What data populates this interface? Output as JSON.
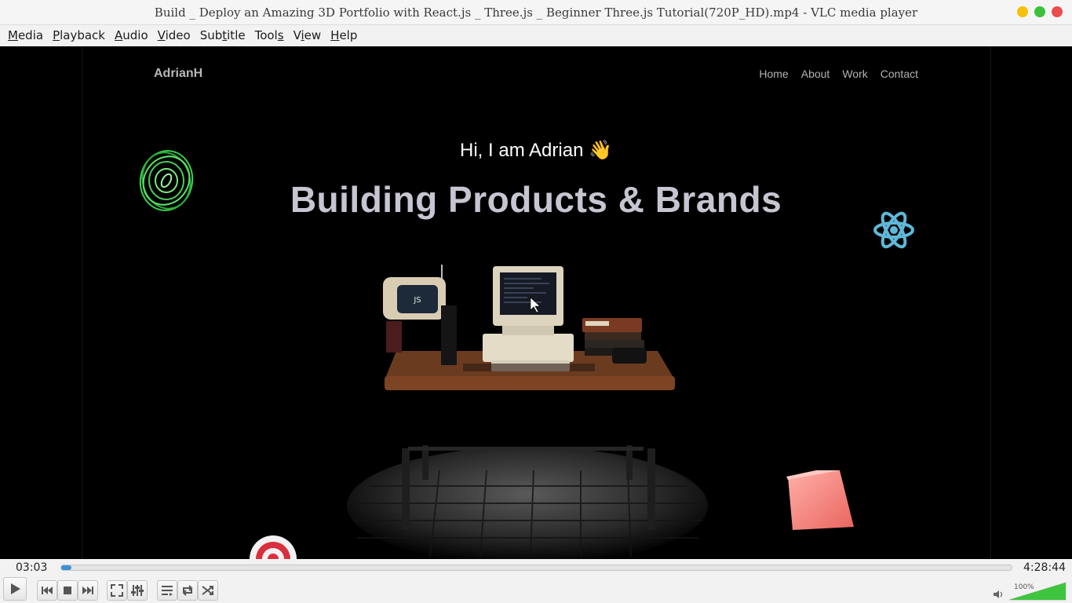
{
  "window": {
    "title": "Build _ Deploy an Amazing 3D Portfolio with React.js _ Three.js _ Beginner Three.js Tutorial(720P_HD).mp4 - VLC media player"
  },
  "window_buttons": {
    "minimize_color": "#f4c20d",
    "maximize_color": "#3cc13b",
    "close_color": "#ec4c4c"
  },
  "menu": {
    "items": [
      {
        "label": "Media",
        "accel": "M",
        "rest": "edia"
      },
      {
        "label": "Playback",
        "accel": "P",
        "rest": "layback"
      },
      {
        "label": "Audio",
        "accel": "A",
        "rest": "udio"
      },
      {
        "label": "Video",
        "accel": "V",
        "rest": "ideo"
      },
      {
        "label": "Subtitle",
        "accel": "t",
        "pre": "Sub",
        "rest": "itle"
      },
      {
        "label": "Tools",
        "accel": "s",
        "pre": "Tool",
        "rest": ""
      },
      {
        "label": "View",
        "accel": "i",
        "pre": "V",
        "rest": "ew"
      },
      {
        "label": "Help",
        "accel": "H",
        "rest": "elp"
      }
    ]
  },
  "video_frame": {
    "logo": "AdrianH",
    "nav": [
      "Home",
      "About",
      "Work",
      "Contact"
    ],
    "greeting": "Hi, I am Adrian 👋",
    "headline": "Building Products & Brands",
    "monitor_badge": "JS"
  },
  "player": {
    "current_time": "03:03",
    "total_time": "4:28:44",
    "progress_fraction": 0.011,
    "volume_label": "100%",
    "volume_fraction": 1.0,
    "accent_color": "#3d8fd6",
    "buttons": [
      "play-icon",
      "previous-icon",
      "stop-icon",
      "next-icon",
      "fullscreen-icon",
      "extended-settings-icon",
      "playlist-icon",
      "loop-icon",
      "shuffle-icon"
    ]
  }
}
